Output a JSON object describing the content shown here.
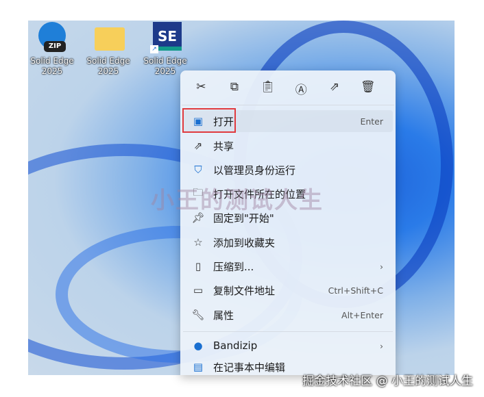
{
  "desktop_icons": [
    {
      "label": "Solid Edge 2025",
      "badge": "ZIP"
    },
    {
      "label": "Solid Edge 2025"
    },
    {
      "label": "Solid Edge 2025",
      "badge": "SE"
    }
  ],
  "toolbar": [
    "cut-icon",
    "copy-icon",
    "paste-icon",
    "rename-icon",
    "share-icon",
    "delete-icon"
  ],
  "menu": [
    {
      "label": "打开",
      "shortcut": "Enter"
    },
    {
      "label": "共享"
    },
    {
      "label": "以管理员身份运行"
    },
    {
      "label": "打开文件所在的位置"
    },
    {
      "label": "固定到\"开始\""
    },
    {
      "label": "添加到收藏夹"
    },
    {
      "label": "压缩到...",
      "arrow": "›"
    },
    {
      "label": "复制文件地址",
      "shortcut": "Ctrl+Shift+C"
    },
    {
      "label": "属性",
      "shortcut": "Alt+Enter"
    },
    {
      "label": "Bandizip",
      "arrow": "›"
    },
    {
      "label": "在记事本中编辑"
    }
  ],
  "watermark": "小王的测试人生",
  "footer": "掘金技术社区 @ 小王的测试人生"
}
